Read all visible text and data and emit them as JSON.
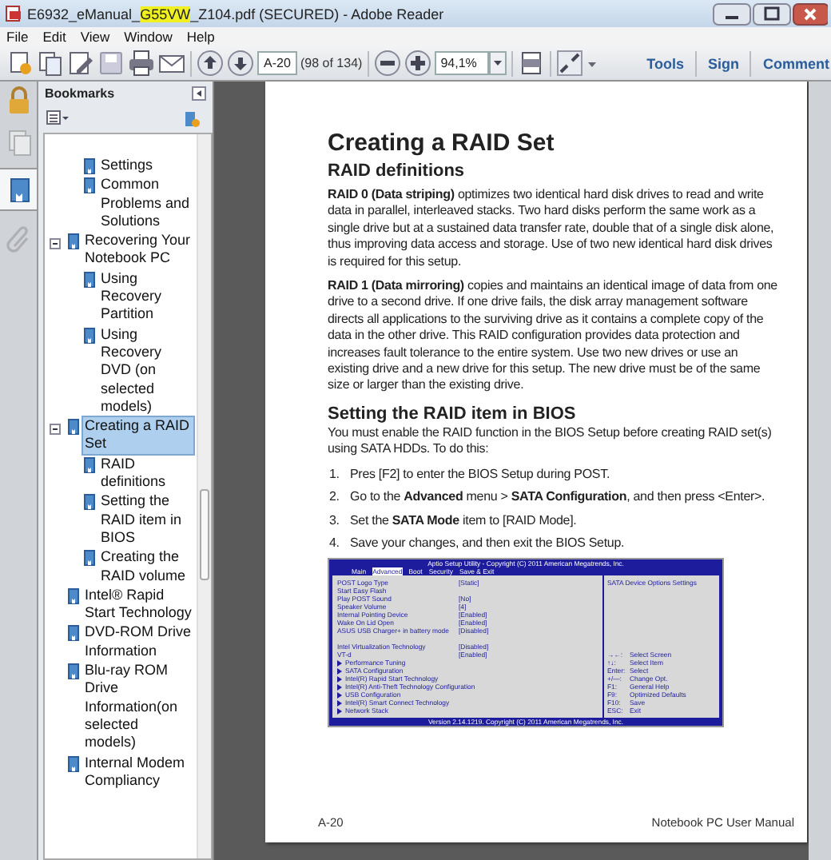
{
  "window": {
    "title_before": "E6932_eManual_",
    "title_highlight": "G55VW",
    "title_after": "_Z104.pdf (SECURED) - Adobe Reader"
  },
  "menu": [
    "File",
    "Edit",
    "View",
    "Window",
    "Help"
  ],
  "toolbar": {
    "page_field": "A-20",
    "page_count": "(98 of 134)",
    "zoom": "94,1%",
    "links": [
      "Tools",
      "Sign",
      "Comment"
    ]
  },
  "nav_tabs": [
    {
      "kind": "pages",
      "selected": false
    },
    {
      "kind": "bookmarks",
      "selected": true
    },
    {
      "kind": "attachments",
      "selected": false
    }
  ],
  "bookmarks": {
    "title": "Bookmarks",
    "items": [
      {
        "children": [
          {
            "label": "Settings",
            "selected": false
          },
          {
            "label": "Common Problems and Solutions",
            "selected": false
          }
        ]
      },
      {
        "label": "Recovering Your Notebook PC",
        "selected": false,
        "expanded": true,
        "children": [
          {
            "label": "Using Recovery Partition",
            "selected": false
          },
          {
            "label": "Using Recovery DVD (on selected models)",
            "selected": false
          }
        ]
      },
      {
        "label": "Creating a RAID Set",
        "selected": true,
        "expanded": true,
        "children": [
          {
            "label": "RAID definitions",
            "selected": false
          },
          {
            "label": "Setting the RAID item in BIOS",
            "selected": false
          },
          {
            "label": "Creating the RAID volume",
            "selected": false
          }
        ]
      },
      {
        "label": "Intel® Rapid Start Technology",
        "selected": false
      },
      {
        "label": "DVD-ROM Drive Information",
        "selected": false
      },
      {
        "label": "Blu-ray ROM Drive Information(on selected models)",
        "selected": false
      },
      {
        "label": "Internal Modem Compliancy",
        "selected": false
      }
    ]
  },
  "document": {
    "heading": "Creating a RAID Set",
    "subheading": "RAID definitions",
    "paragraphs": [
      "**RAID 0 (Data striping)** optimizes two identical hard disk drives to read and write data in parallel, interleaved stacks. Two hard disks perform the same work as a single drive but at a sustained data transfer rate, double that of a single disk alone, thus improving data access and storage. Use of two new identical hard disk drives is required for this setup.",
      "**RAID 1 (Data mirroring)** copies and maintains an identical image of data from one drive to a second drive. If one drive fails, the disk array management software directs all applications to the surviving drive as it contains a complete copy of the data in the other drive. This RAID configuration provides data protection and increases fault tolerance to the entire system. Use two new drives or use an existing drive and a new drive for this setup. The new drive must be of the same size or larger than the existing drive."
    ],
    "section": "Setting the RAID item in BIOS",
    "intro": "You must enable the RAID function in the BIOS Setup before creating RAID set(s) using SATA HDDs. To do this:",
    "steps": [
      {
        "number": "1.",
        "text": "Pres [F2] to enter the BIOS Setup during POST."
      },
      {
        "number": "2.",
        "text": "Go to the **Advanced** menu > **SATA Configuration**, and then press <Enter>."
      },
      {
        "number": "3.",
        "text": "Set the **SATA Mode** item to [RAID Mode]."
      },
      {
        "number": "4.",
        "text": "Save your changes, and then exit the BIOS Setup."
      }
    ],
    "bios": {
      "header": "Aptio Setup Utility - Copyright (C) 2011 American Megatrends, Inc.",
      "tabs": [
        {
          "label": "Main",
          "selected": false
        },
        {
          "label": "Advanced",
          "selected": true
        },
        {
          "label": "Boot",
          "selected": false
        },
        {
          "label": "Security",
          "selected": false
        },
        {
          "label": "Save & Exit",
          "selected": false
        }
      ],
      "settings": [
        {
          "name": "POST Logo Type",
          "value": "[Static]"
        },
        {
          "name": "Start Easy Flash"
        },
        {
          "name": "Play POST Sound",
          "value": "[No]"
        },
        {
          "name": "Speaker Volume",
          "value": "[4]"
        },
        {
          "name": "Internal Pointing Device",
          "value": "[Enabled]"
        },
        {
          "name": "Wake On Lid Open",
          "value": "[Enabled]"
        },
        {
          "name": "ASUS USB Charger+ in battery mode",
          "value": "[Disabled]"
        },
        {
          "name": "Intel Virtualization Technology",
          "value": "[Disabled]"
        },
        {
          "name": "VT-d",
          "value": "[Enabled]"
        }
      ],
      "submenus": [
        "Performance Tuning",
        "SATA Configuration",
        "Intel(R) Rapid Start Technology",
        "Intel(R) Anti-Theft Technology Configuration",
        "USB Configuration",
        "Intel(R) Smart Connect Technology",
        "Network Stack"
      ],
      "help": "SATA Device Options Settings",
      "keys": [
        {
          "key": "→←:",
          "action": "Select Screen"
        },
        {
          "key": "↑↓:",
          "action": "Select Item"
        },
        {
          "key": "Enter:",
          "action": "Select"
        },
        {
          "key": "+/—:",
          "action": "Change Opt."
        },
        {
          "key": "F1:",
          "action": "General Help"
        },
        {
          "key": "F9:",
          "action": "Optimized Defaults"
        },
        {
          "key": "F10:",
          "action": "Save"
        },
        {
          "key": "ESC:",
          "action": "Exit"
        }
      ],
      "footer": "Version 2.14.1219. Copyright (C) 2011 American Megatrends, Inc."
    },
    "footer_left": "A-20",
    "footer_right": "Notebook PC User Manual"
  }
}
